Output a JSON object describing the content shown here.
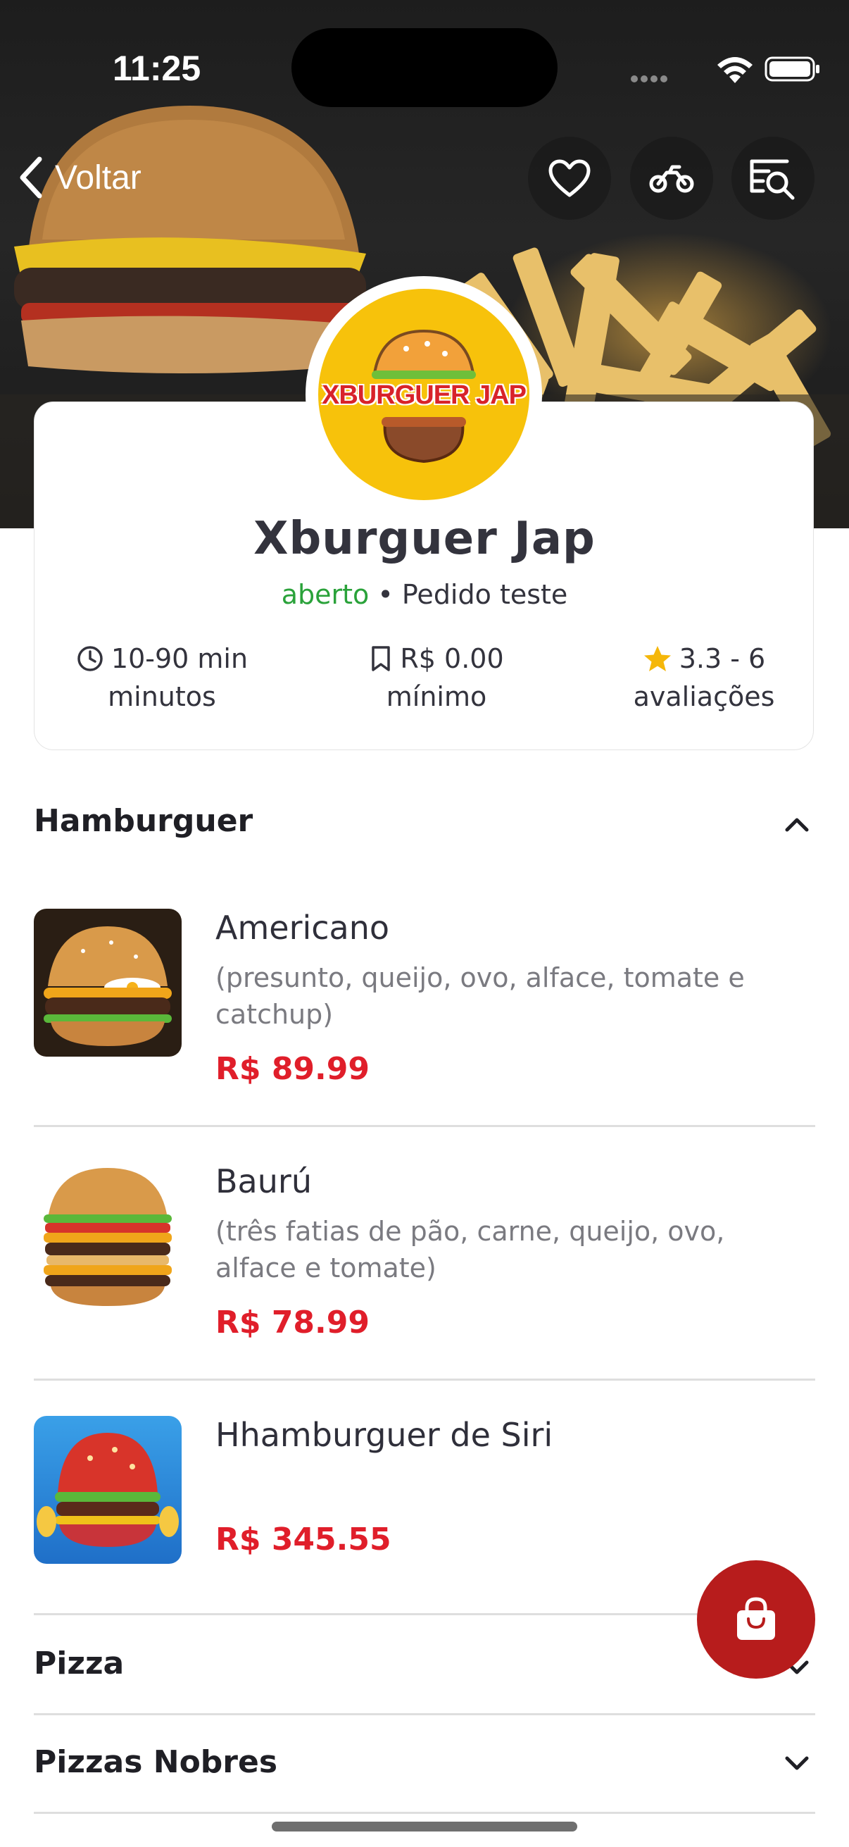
{
  "status_bar": {
    "time": "11:25"
  },
  "header": {
    "back_label": "Voltar",
    "icons": [
      "heart-icon",
      "motorcycle-icon",
      "menu-search-icon"
    ]
  },
  "store": {
    "logo_text": "XBURGUER JAP",
    "name": "Xburguer Jap",
    "status": "aberto",
    "separator": "•",
    "note": "Pedido teste",
    "stats": [
      {
        "value": "10-90 min",
        "label": "minutos",
        "icon": "clock-icon"
      },
      {
        "value": "R$ 0.00",
        "label": "mínimo",
        "icon": "bookmark-icon"
      },
      {
        "value": "3.3 - 6",
        "label": "avaliações",
        "icon": "star-icon"
      }
    ]
  },
  "colors": {
    "open": "#2aa23a",
    "price": "#e01e2a",
    "fab": "#b71c1c",
    "logo_bg": "#f7c20b"
  },
  "menu": {
    "sections": [
      {
        "title": "Hamburguer",
        "expanded": true,
        "items": [
          {
            "name": "Americano",
            "description": "(presunto, queijo, ovo, alface, tomate e catchup)",
            "price": "R$ 89.99"
          },
          {
            "name": "Baurú",
            "description": "(três fatias de pão, carne, queijo, ovo, alface e tomate)",
            "price": "R$ 78.99"
          },
          {
            "name": "Hhamburguer de Siri",
            "description": "",
            "price": "R$ 345.55"
          }
        ]
      },
      {
        "title": "Pizza",
        "expanded": false
      },
      {
        "title": "Pizzas Nobres",
        "expanded": false
      }
    ]
  },
  "cart_button": {
    "icon": "shopping-bag-icon"
  }
}
